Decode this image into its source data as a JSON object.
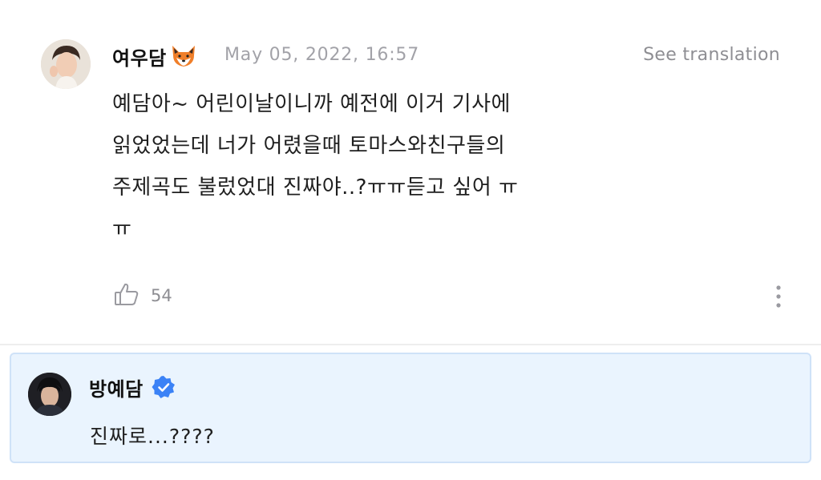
{
  "comment": {
    "author": "여우담",
    "author_icon": "fox-icon",
    "timestamp": "May 05, 2022, 16:57",
    "translate_label": "See translation",
    "body_lines": [
      "예담아~ 어린이날이니까 예전에 이거 기사에",
      "읽었었는데 너가 어렸을때 토마스와친구들의",
      "주제곡도 불렀었대 진짜야..?ㅠㅠ듣고 싶어 ㅠ",
      "ㅠ"
    ],
    "like_icon": "thumbs-up-icon",
    "like_count": "54",
    "more_icon": "vertical-ellipsis-icon"
  },
  "reply": {
    "author": "방예담",
    "verified_icon": "verified-badge-icon",
    "text": "진짜로...????",
    "colors": {
      "background": "#eaf4fe",
      "border": "#cfe2f8",
      "verified": "#3b82f6"
    }
  }
}
